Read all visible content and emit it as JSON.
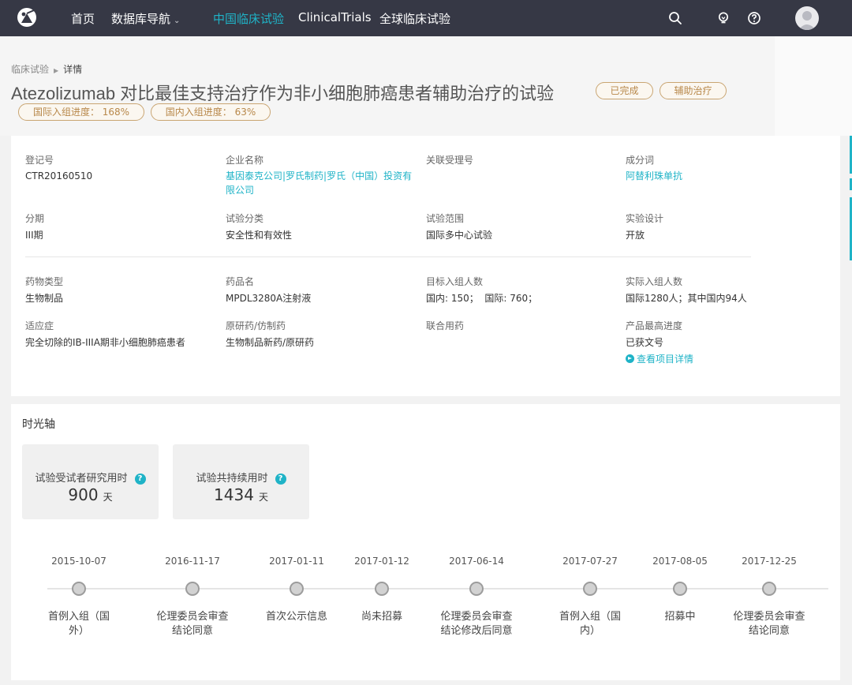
{
  "nav": {
    "items": [
      {
        "label": "首页"
      },
      {
        "label": "数据库导航"
      },
      {
        "label": "中国临床试验"
      },
      {
        "label": "ClinicalTrials"
      },
      {
        "label": "全球临床试验"
      }
    ],
    "active_color": "#1fb3c7",
    "bg_color": "#363845",
    "icons": [
      "search-icon",
      "lightbulb-icon",
      "help-icon",
      "avatar"
    ]
  },
  "breadcrumb": {
    "root": "临床试验",
    "current": "详情"
  },
  "title": "Atezolizumab 对比最佳支持治疗作为非小细胞肺癌患者辅助治疗的试验",
  "tags": [
    "已完成",
    "辅助治疗"
  ],
  "progress_tags": [
    "国际入组进度： 168%",
    "国内入组进度： 63%"
  ],
  "info": {
    "rows": [
      [
        {
          "label": "登记号",
          "value": "CTR20160510",
          "link": false
        },
        {
          "label": "企业名称",
          "value": "基因泰克公司|罗氏制药|罗氏（中国）投资有限公司",
          "link": true
        },
        {
          "label": "关联受理号",
          "value": "",
          "link": false
        },
        {
          "label": "成分词",
          "value": "阿替利珠单抗",
          "link": true
        }
      ],
      [
        {
          "label": "分期",
          "value": "III期",
          "link": false
        },
        {
          "label": "试验分类",
          "value": "安全性和有效性",
          "link": false
        },
        {
          "label": "试验范围",
          "value": "国际多中心试验",
          "link": false
        },
        {
          "label": "实验设计",
          "value": "开放",
          "link": false
        }
      ],
      [
        {
          "label": "药物类型",
          "value": "生物制品",
          "link": false
        },
        {
          "label": "药品名",
          "value": "MPDL3280A注射液",
          "link": false
        },
        {
          "label": "目标入组人数",
          "value": "国内: 150；  国际: 760；",
          "link": false
        },
        {
          "label": "实际入组人数",
          "value": "国际1280人；其中国内94人",
          "link": false
        }
      ],
      [
        {
          "label": "适应症",
          "value": "完全切除的IB-IIIA期非小细胞肺癌患者",
          "link": false
        },
        {
          "label": "原研药/仿制药",
          "value": "生物制品新药/原研药",
          "link": false
        },
        {
          "label": "联合用药",
          "value": "",
          "link": false
        },
        {
          "label": "产品最高进度",
          "value": "已获文号",
          "link": false
        }
      ]
    ],
    "detail_link": "查看项目详情"
  },
  "timeline": {
    "title": "时光轴",
    "stats": [
      {
        "label": "试验受试者研究用时",
        "value": "900",
        "unit": "天"
      },
      {
        "label": "试验共持续用时",
        "value": "1434",
        "unit": "天"
      }
    ],
    "events": [
      {
        "date": "2015-10-07",
        "text": "首例入组（国外）"
      },
      {
        "date": "2016-11-17",
        "text": "伦理委员会审查结论同意"
      },
      {
        "date": "2017-01-11",
        "text": "首次公示信息"
      },
      {
        "date": "2017-01-12",
        "text": "尚未招募"
      },
      {
        "date": "2017-06-14",
        "text": "伦理委员会审查结论修改后同意"
      },
      {
        "date": "2017-07-27",
        "text": "首例入组（国内）"
      },
      {
        "date": "2017-08-05",
        "text": "招募中"
      },
      {
        "date": "2017-12-25",
        "text": "伦理委员会审查结论同意"
      }
    ]
  }
}
